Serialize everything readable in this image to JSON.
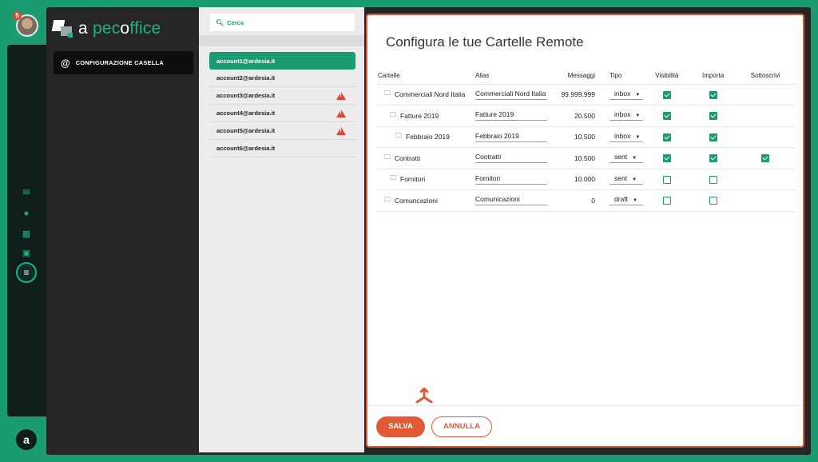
{
  "user": {
    "notifications": "5"
  },
  "brand": {
    "pre": "a",
    "name_a": "pec",
    "name_b": "o",
    "name_c": "ffice"
  },
  "nav": {
    "config_label": "CONFIGURAZIONE CASELLA"
  },
  "search": {
    "placeholder": "Cerca"
  },
  "accounts": [
    {
      "email": "account1@ardesia.it",
      "warning": false,
      "active": true
    },
    {
      "email": "account2@ardesia.it",
      "warning": false,
      "active": false
    },
    {
      "email": "account3@ardesia.it",
      "warning": true,
      "active": false
    },
    {
      "email": "account4@ardesia.it",
      "warning": true,
      "active": false
    },
    {
      "email": "account5@ardesia.it",
      "warning": true,
      "active": false
    },
    {
      "email": "account6@ardesia.it",
      "warning": false,
      "active": false
    }
  ],
  "main": {
    "title": "Configura le tue Cartelle Remote",
    "headers": {
      "cartelle": "Cartelle",
      "alias": "Alias",
      "messaggi": "Messaggi",
      "tipo": "Tipo",
      "visibilita": "Visibilità",
      "importa": "Importa",
      "sottoscrivi": "Sottoscrivi"
    },
    "rows": [
      {
        "folder": "Commerciali Nord Italia",
        "alias": "Commerciali Nord Italia",
        "messages": "99.999.999",
        "type": "inbox",
        "visible": true,
        "import": true,
        "subscribe": null
      },
      {
        "folder": "Fatture 2019",
        "alias": "Fatture 2019",
        "messages": "20.500",
        "type": "inbox",
        "visible": true,
        "import": true,
        "subscribe": null
      },
      {
        "folder": "Febbraio 2019",
        "alias": "Febbraio 2019",
        "messages": "10.500",
        "type": "inbox",
        "visible": true,
        "import": true,
        "subscribe": null
      },
      {
        "folder": "Contratti",
        "alias": "Contratti",
        "messages": "10.500",
        "type": "sent",
        "visible": true,
        "import": true,
        "subscribe": true
      },
      {
        "folder": "Fornitori",
        "alias": "Fornitori",
        "messages": "10.000",
        "type": "sent",
        "visible": false,
        "import": false,
        "subscribe": null
      },
      {
        "folder": "Comuncazioni",
        "alias": "Comunicazioni",
        "messages": "0",
        "type": "draft",
        "visible": false,
        "import": false,
        "subscribe": null
      }
    ],
    "save_label": "SALVA",
    "cancel_label": "ANNULLA"
  },
  "colors": {
    "accent": "#1a9b72",
    "warning": "#e2452b",
    "primary_action": "#e05a35"
  },
  "icons": [
    "mail-icon",
    "user-icon",
    "contacts-icon",
    "calendar-icon",
    "settings-sliders-icon",
    "folder-icon",
    "search-icon",
    "warning-icon",
    "cursor-icon"
  ]
}
